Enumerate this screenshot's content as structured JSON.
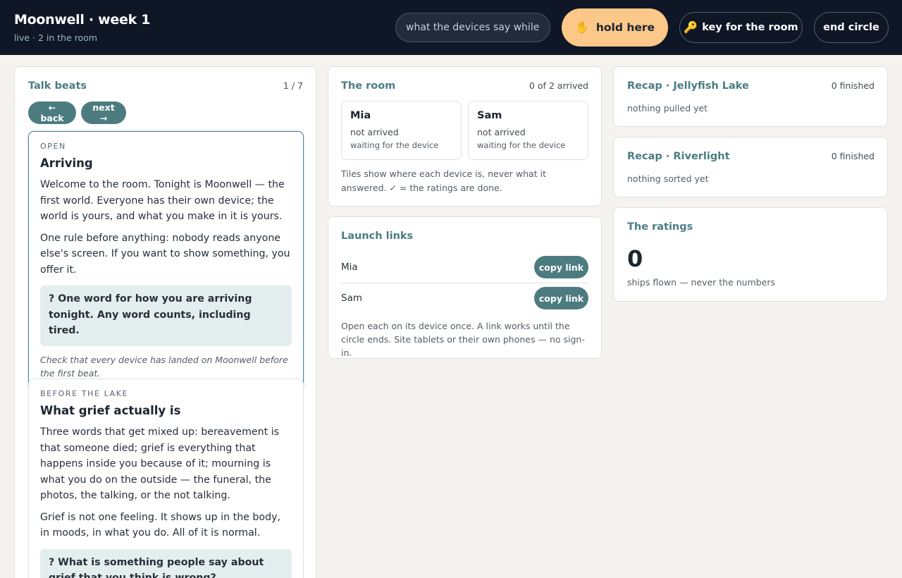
{
  "header": {
    "title": "Moonwell · week 1",
    "subtitle": "live · 2 in the room",
    "say_input_value": "what the devices say while h",
    "hold_label": "hold here",
    "hold_icon": "raised-hand-icon",
    "key_label": "key for the room",
    "key_icon": "key-icon",
    "end_label": "end circle"
  },
  "beats": {
    "title": "Talk beats",
    "counter": "1 / 7",
    "back_label": "← back",
    "next_label": "next →",
    "items": [
      {
        "kicker": "OPEN",
        "title": "Arriving",
        "paragraphs": [
          "Welcome to the room. Tonight is Moonwell — the first world. Everyone has their own device; the world is yours, and what you make in it is yours.",
          "One rule before anything: nobody reads anyone else's screen. If you want to show something, you offer it."
        ],
        "question": "? One word for how you are arriving tonight. Any word counts, including tired.",
        "note": "Check that every device has landed on Moonwell before the first beat."
      },
      {
        "kicker": "BEFORE THE LAKE",
        "title": "What grief actually is",
        "paragraphs": [
          "Three words that get mixed up: bereavement is that someone died; grief is everything that happens inside you because of it; mourning is what you do on the outside — the funeral, the photos, the talking, or the not talking.",
          "Grief is not one feeling. It shows up in the body, in moods, in what you do. All of it is normal."
        ],
        "question": "? What is something people say about grief that you think is wrong?"
      }
    ]
  },
  "room": {
    "title": "The room",
    "arrived": "0 of 2 arrived",
    "tiles": [
      {
        "name": "Mia",
        "status": "not arrived",
        "sub": "waiting for the device"
      },
      {
        "name": "Sam",
        "status": "not arrived",
        "sub": "waiting for the device"
      }
    ],
    "note": "Tiles show where each device is, never what it answered. ✓ = the ratings are done."
  },
  "links": {
    "title": "Launch links",
    "rows": [
      {
        "name": "Mia",
        "button": "copy link"
      },
      {
        "name": "Sam",
        "button": "copy link"
      }
    ],
    "note": "Open each on its device once. A link works until the circle ends. Site tablets or their own phones — no sign-in."
  },
  "recap_jellyfish": {
    "title": "Recap · Jellyfish Lake",
    "count": "0 finished",
    "body": "nothing pulled yet"
  },
  "recap_riverlight": {
    "title": "Recap · Riverlight",
    "count": "0 finished",
    "body": "nothing sorted yet"
  },
  "ratings": {
    "title": "The ratings",
    "value": "0",
    "caption": "ships flown — never the numbers"
  }
}
